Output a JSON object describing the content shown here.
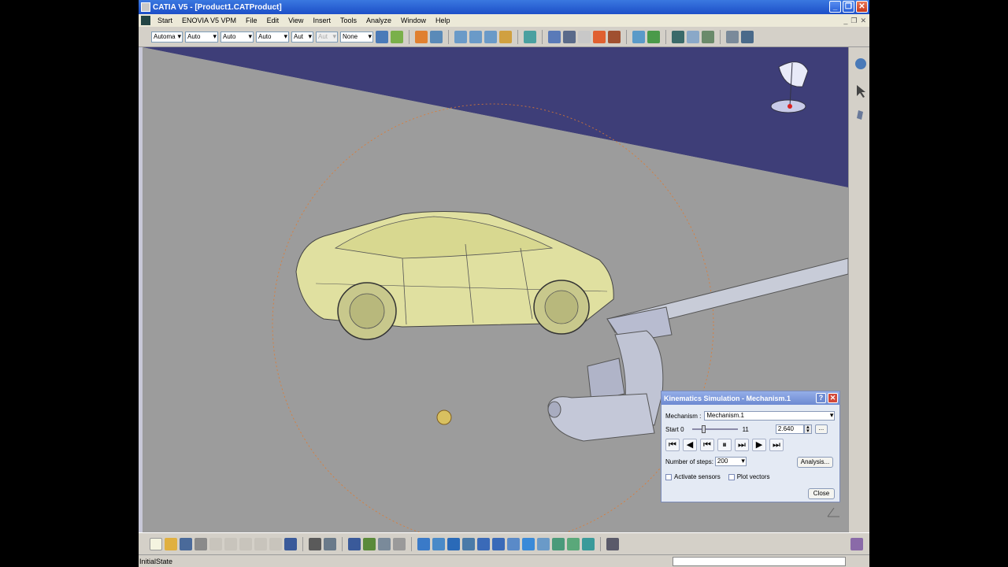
{
  "window": {
    "title": "CATIA V5 - [Product1.CATProduct]"
  },
  "menu": {
    "items": [
      "Start",
      "ENOVIA V5 VPM",
      "File",
      "Edit",
      "View",
      "Insert",
      "Tools",
      "Analyze",
      "Window",
      "Help"
    ]
  },
  "toolbar": {
    "combo1": "Automa",
    "combo2": "Auto",
    "combo3": "Auto",
    "combo4": "Auto",
    "combo5": "Aut",
    "combo6": "Aut",
    "combo7": "None"
  },
  "status": {
    "text": "InitialState"
  },
  "dialog": {
    "title": "Kinematics Simulation - Mechanism.1",
    "help": "?",
    "mechanism_label": "Mechanism :",
    "mechanism_value": "Mechanism.1",
    "start_label": "Start 0",
    "end_label": "11",
    "value": "2.640",
    "steps_label": "Number of steps:",
    "steps_value": "200",
    "analysis_label": "Analysis...",
    "activate_sensors_label": "Activate sensors",
    "plot_vectors_label": "Plot vectors",
    "close_label": "Close",
    "slider_position": 0.24
  },
  "colors": {
    "background_sky": "#3e3e78",
    "background_ground": "#9c9c9c",
    "car_body": "#e0e0a0",
    "mechanism": "#c0c4d4",
    "orbit": "#e07a30"
  }
}
